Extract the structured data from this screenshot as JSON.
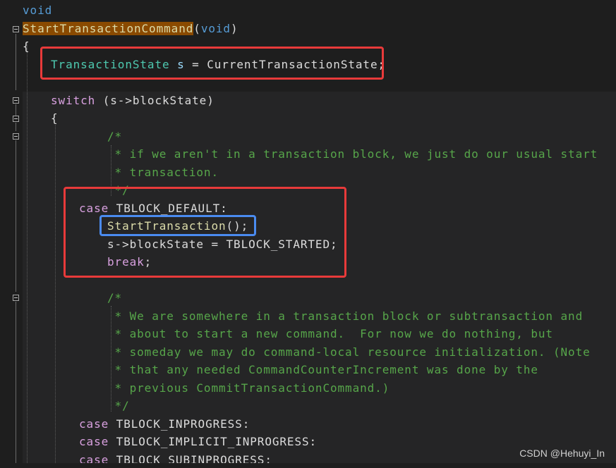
{
  "code": {
    "l1_void": "void",
    "l2_func": "StartTransactionCommand",
    "l2_paren": "(",
    "l2_void": "void",
    "l2_close": ")",
    "l3_brace": "{",
    "l4_type": "TransactionState",
    "l4_var": "s",
    "l4_rest": " = CurrentTransactionState;",
    "l5_switch": "switch",
    "l5_rest": " (s->blockState)",
    "l6_brace": "{",
    "c1_l1": "/*",
    "c1_l2": " * if we aren't in a transaction block, we just do our usual start",
    "c1_l3": " * transaction.",
    "c1_l4": " */",
    "case1_kw": "case",
    "case1_val": " TBLOCK_DEFAULT:",
    "stmt_call": "StartTransaction",
    "stmt_call_rest": "();",
    "stmt_assign": "s->blockState = TBLOCK_STARTED;",
    "stmt_break": "break",
    "stmt_break_rest": ";",
    "c2_l1": "/*",
    "c2_l2": " * We are somewhere in a transaction block or subtransaction and",
    "c2_l3": " * about to start a new command.  For now we do nothing, but",
    "c2_l4": " * someday we may do command-local resource initialization. (Note",
    "c2_l5": " * that any needed CommandCounterIncrement was done by the",
    "c2_l6": " * previous CommitTransactionCommand.)",
    "c2_l7": " */",
    "case2_kw": "case",
    "case2_val": " TBLOCK_INPROGRESS:",
    "case3_kw": "case",
    "case3_val": " TBLOCK_IMPLICIT_INPROGRESS:",
    "case4_kw": "case",
    "case4_val": " TBLOCK_SUBINPROGRESS:"
  },
  "watermark": "CSDN @Hehuyi_In",
  "colors": {
    "background": "#1e1e1e",
    "keyword": "#569cd6",
    "control": "#d8a0df",
    "type": "#4ec9b0",
    "comment": "#57a64a",
    "highlight_red": "#e83a3a",
    "highlight_blue": "#4a8bf0"
  }
}
